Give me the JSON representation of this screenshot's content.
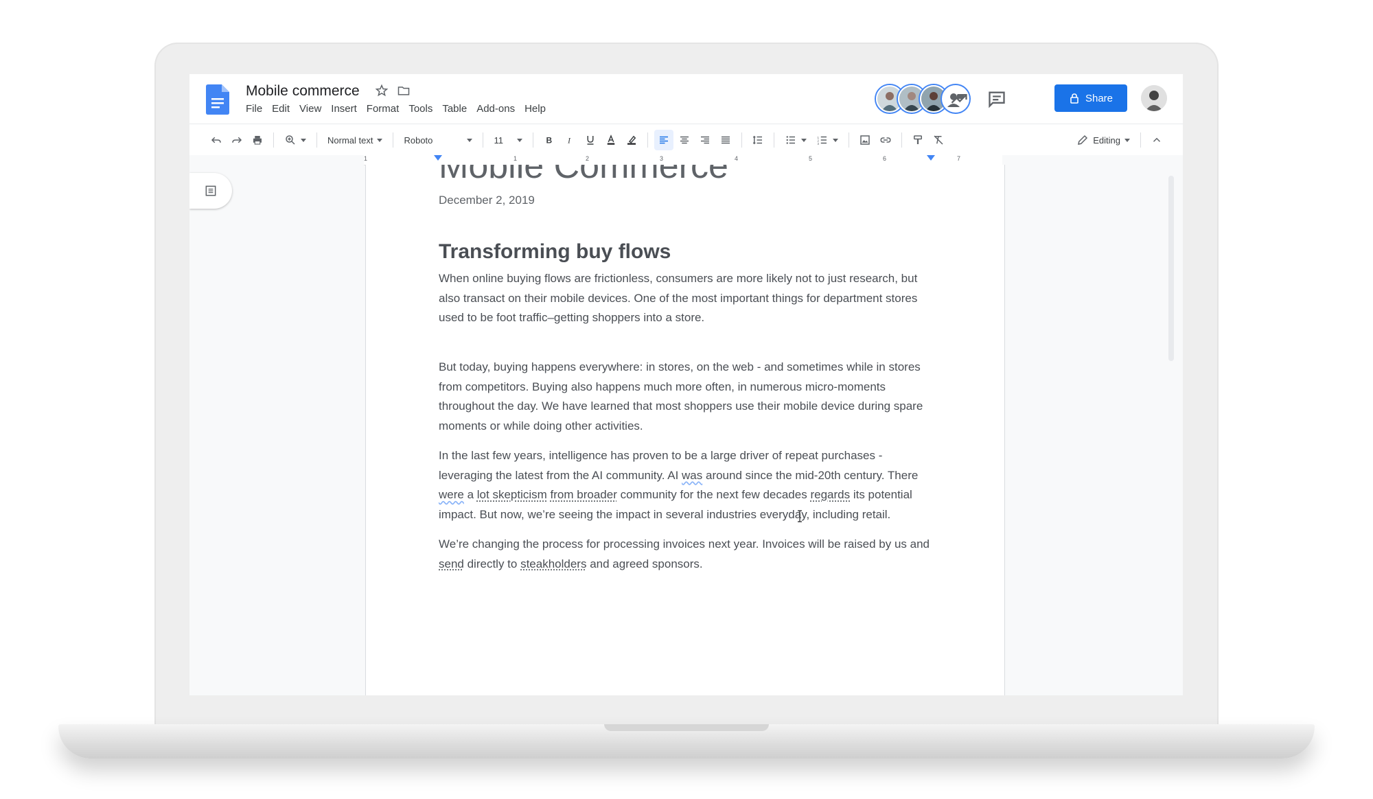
{
  "doc": {
    "title": "Mobile commerce",
    "menu": [
      "File",
      "Edit",
      "View",
      "Insert",
      "Format",
      "Tools",
      "Table",
      "Add-ons",
      "Help"
    ]
  },
  "header": {
    "share_label": "Share",
    "icons": [
      "trending-icon",
      "comments-icon",
      "lock-icon"
    ],
    "collaborators": [
      "collaborator-1",
      "collaborator-2",
      "collaborator-3",
      "collaborator-4"
    ]
  },
  "toolbar": {
    "style_select": "Normal text",
    "font_select": "Roboto",
    "size_select": "11",
    "mode_label": "Editing"
  },
  "ruler": {
    "numbers": [
      "1",
      "1",
      "2",
      "3",
      "4",
      "5",
      "6",
      "7"
    ]
  },
  "content": {
    "heading_top": "Mobile Commerce",
    "date": "December 2, 2019",
    "section_title": "Transforming buy flows",
    "p1": "When online buying flows are frictionless, consumers are more likely not to  just research, but also transact on their mobile devices. One of the most important things for department stores used to be foot traffic–getting shoppers into a store.",
    "p2": "But today, buying happens everywhere: in stores, on the web - and sometimes while in stores from competitors. Buying also happens much more often, in numerous micro-moments throughout the day. We have learned that most shoppers use their mobile device during spare moments or while doing other activities.",
    "p3a": "In the last few years, intelligence has proven to be a large driver of repeat purchases - leveraging the latest from the AI community. AI ",
    "p3_was": "was",
    "p3b": " around since the mid-20th century. There ",
    "p3_were": "were",
    "p3c": " a ",
    "p3_lot": "lot skepticism",
    "p3d": " ",
    "p3_from": "from broader",
    "p3e": " community for the next few decades ",
    "p3_regards": "regards",
    "p3f": " its potential impact. But now, we’re seeing the impact in several industries everyday, including retail.",
    "p4a": "We’re changing the process for processing invoices next year. Invoices will be raised by us and ",
    "p4_send": "send",
    "p4b": " directly to ",
    "p4_stake": "steakholders",
    "p4c": " and agreed sponsors."
  },
  "colors": {
    "accent": "#1a73e8",
    "docs_blue": "#4285f4",
    "text": "#4a4e54"
  }
}
